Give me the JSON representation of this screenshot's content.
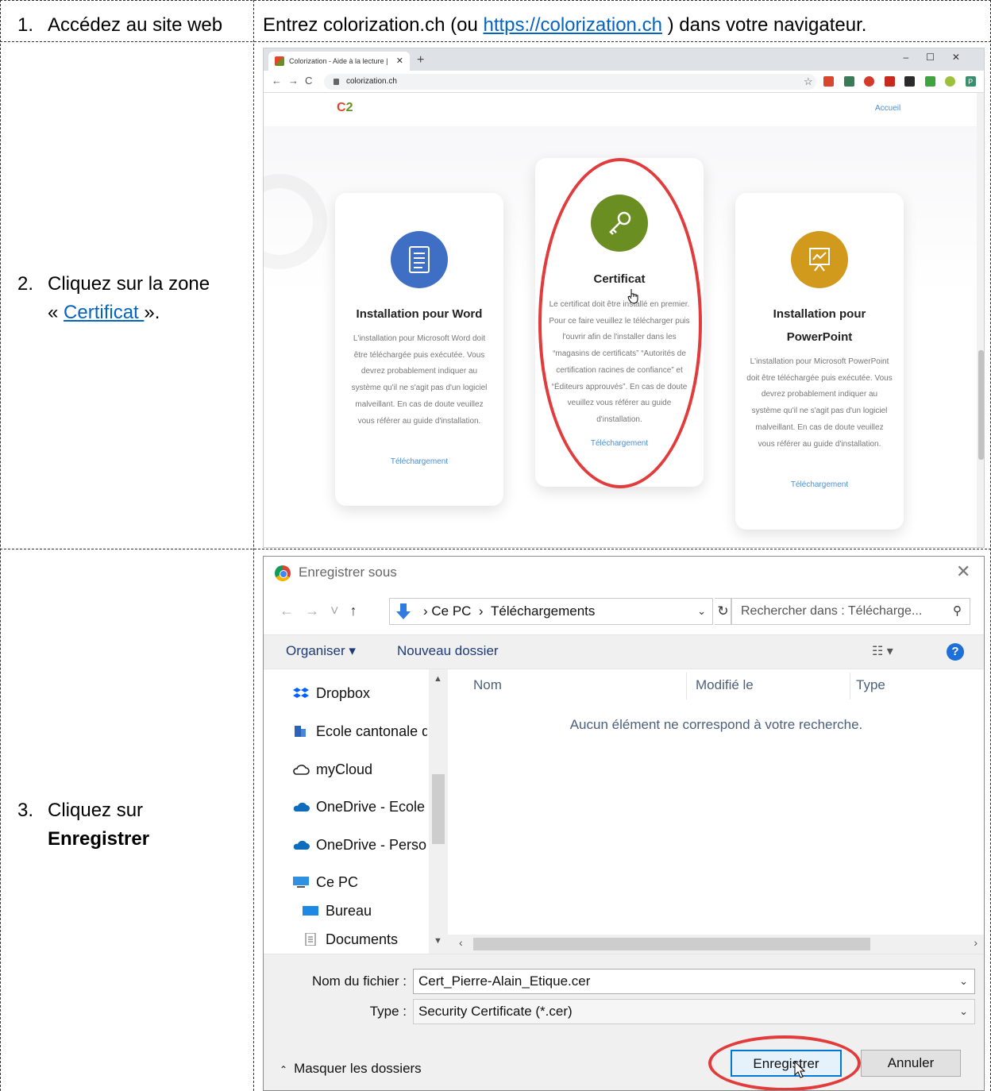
{
  "rows": [
    {
      "num": "1.",
      "text": "Accédez au site web"
    },
    {
      "num": "2.",
      "text_before": "Cliquez sur la zone",
      "text_open": "« ",
      "link": "Certificat ",
      "text_close": "»."
    },
    {
      "num": "3.",
      "text_before": "Cliquez sur",
      "bold": "Enregistrer"
    }
  ],
  "row1_instruction": {
    "before": "Entrez colorization.ch (ou ",
    "link": "https://colorization.ch",
    "after": " ) dans votre navigateur."
  },
  "browser": {
    "tab_title": "Colorization - Aide à la lecture |",
    "url": "colorization.ch",
    "nav_link": "Accueil",
    "avatar": "P",
    "cards": [
      {
        "title": "Installation pour Word",
        "description": "L'installation pour Microsoft Word doit être téléchargée puis exécutée. Vous devrez probablement indiquer au système qu'il ne s'agit pas d'un logiciel malveillant. En cas de doute veuillez vous référer au guide d'installation.",
        "link": "Téléchargement",
        "color": "#3f6fc5"
      },
      {
        "title": "Certificat",
        "description": "Le certificat doit être installé en premier. Pour ce faire veuillez le télécharger puis l'ouvrir afin de l'installer dans les “magasins de certificats” “Autorités de certification racines de confiance” et “Éditeurs approuvés”. En cas de doute veuillez vous référer au guide d'installation.",
        "link": "Téléchargement",
        "color": "#6b8e23"
      },
      {
        "title_line1": "Installation pour",
        "title_line2": "PowerPoint",
        "description": "L'installation pour Microsoft PowerPoint doit être téléchargée puis exécutée. Vous devrez probablement indiquer au système qu'il ne s'agit pas d'un logiciel malveillant. En cas de doute veuillez vous référer au guide d'installation.",
        "link": "Téléchargement",
        "color": "#d19a1c"
      }
    ]
  },
  "dialog": {
    "title": "Enregistrer sous",
    "path": [
      "Ce PC",
      "Téléchargements"
    ],
    "search_placeholder": "Rechercher dans : Télécharge...",
    "organize": "Organiser ▾",
    "new_folder": "Nouveau dossier",
    "tree": [
      "Dropbox",
      "Ecole cantonale d",
      "myCloud",
      "OneDrive - Ecole c",
      "OneDrive - Persor",
      "Ce PC",
      "Bureau",
      "Documents"
    ],
    "columns": [
      "Nom",
      "Modifié le",
      "Type"
    ],
    "empty_message": "Aucun élément ne correspond à votre recherche.",
    "filename_label": "Nom du fichier :",
    "filename": "Cert_Pierre-Alain_Etique.cer",
    "type_label": "Type :",
    "type": "Security Certificate (*.cer)",
    "hide_folders": "Masquer les dossiers",
    "save": "Enregistrer",
    "cancel": "Annuler"
  }
}
